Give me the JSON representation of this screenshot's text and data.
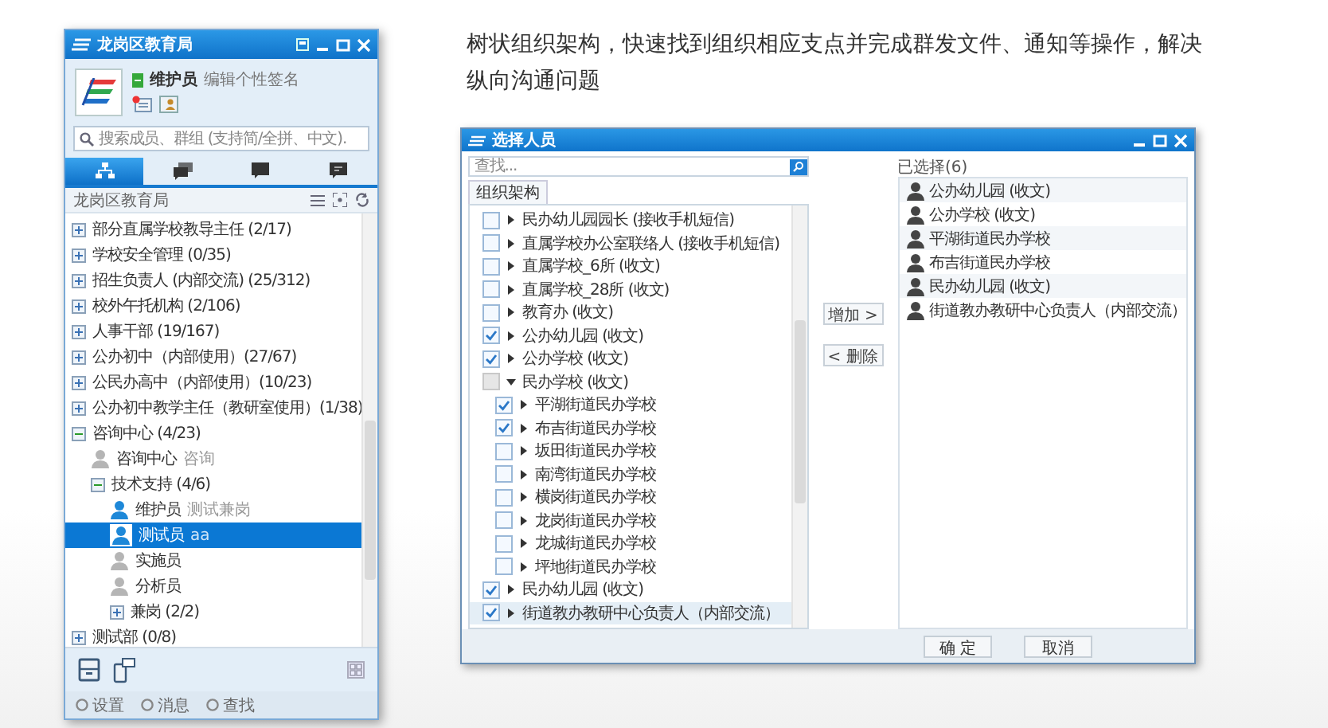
{
  "caption": "树状组织架构，快速找到组织相应支点并完成群发文件、通知等操作，解决纵向沟通问题",
  "im_window": {
    "title": "龙岗区教育局",
    "user": {
      "name": "维护员",
      "signature": "编辑个性签名",
      "online": true
    },
    "search": {
      "placeholder": "搜索成员、群组 (支持简/全拼、中文)."
    },
    "tabs": [
      {
        "kind": "org",
        "selected": true
      },
      {
        "kind": "groups",
        "selected": false
      },
      {
        "kind": "chat",
        "selected": false
      },
      {
        "kind": "notice",
        "selected": false
      }
    ],
    "org_header": "龙岗区教育局",
    "tree": [
      {
        "kind": "group",
        "label": "部分直属学校教导主任 (2/17)",
        "expanded": false,
        "selected": false
      },
      {
        "kind": "group",
        "label": "学校安全管理 (0/35)",
        "expanded": false,
        "selected": false
      },
      {
        "kind": "group",
        "label": "招生负责人 (内部交流) (25/312)",
        "expanded": false,
        "selected": false
      },
      {
        "kind": "group",
        "label": "校外午托机构 (2/106)",
        "expanded": false,
        "selected": false
      },
      {
        "kind": "group",
        "label": "人事干部 (19/167)",
        "expanded": false,
        "selected": false
      },
      {
        "kind": "group",
        "label": "公办初中（内部使用）(27/67)",
        "expanded": false,
        "selected": false
      },
      {
        "kind": "group",
        "label": "公民办高中（内部使用）(10/23)",
        "expanded": false,
        "selected": false
      },
      {
        "kind": "group",
        "label": "公办初中教学主任（教研室使用）(1/38)",
        "expanded": false,
        "selected": false
      },
      {
        "kind": "group",
        "label": "咨询中心 (4/23)",
        "expanded": true,
        "selected": false,
        "children": [
          {
            "kind": "member",
            "name": "咨询中心",
            "note": "咨询",
            "online": false,
            "selected": false
          },
          {
            "kind": "group",
            "label": "技术支持 (4/6)",
            "expanded": true,
            "selected": false,
            "children": [
              {
                "kind": "member",
                "name": "维护员",
                "note": "测试兼岗",
                "online": true,
                "selected": false
              },
              {
                "kind": "member",
                "name": "测试员",
                "note": "aa",
                "online": true,
                "selected": true
              },
              {
                "kind": "member",
                "name": "实施员",
                "online": false,
                "selected": false
              },
              {
                "kind": "member",
                "name": "分析员",
                "online": false,
                "selected": false
              },
              {
                "kind": "group",
                "label": "兼岗 (2/2)",
                "expanded": false,
                "selected": false
              }
            ]
          }
        ]
      },
      {
        "kind": "group",
        "label": "测试部 (0/8)",
        "expanded": false,
        "selected": false
      }
    ],
    "footer": [
      "设置",
      "消息",
      "查找"
    ]
  },
  "dialog": {
    "title": "选择人员",
    "search": {
      "placeholder": "查找..."
    },
    "tab": "组织架构",
    "tree": [
      {
        "label": "民办幼儿园园长 (接收手机短信)",
        "checked": false,
        "partial": false,
        "expanded": false,
        "highlighted": false
      },
      {
        "label": "直属学校办公室联络人 (接收手机短信)",
        "checked": false,
        "partial": false,
        "expanded": false,
        "highlighted": false
      },
      {
        "label": "直属学校_6所 (收文)",
        "checked": false,
        "partial": false,
        "expanded": false,
        "highlighted": false
      },
      {
        "label": "直属学校_28所 (收文)",
        "checked": false,
        "partial": false,
        "expanded": false,
        "highlighted": false
      },
      {
        "label": "教育办 (收文)",
        "checked": false,
        "partial": false,
        "expanded": false,
        "highlighted": false
      },
      {
        "label": "公办幼儿园 (收文)",
        "checked": true,
        "partial": false,
        "expanded": false,
        "highlighted": false
      },
      {
        "label": "公办学校 (收文)",
        "checked": true,
        "partial": false,
        "expanded": false,
        "highlighted": false
      },
      {
        "label": "民办学校 (收文)",
        "checked": false,
        "partial": true,
        "expanded": true,
        "highlighted": false,
        "children": [
          {
            "label": "平湖街道民办学校",
            "checked": true,
            "partial": false,
            "expanded": false,
            "highlighted": false
          },
          {
            "label": "布吉街道民办学校",
            "checked": true,
            "partial": false,
            "expanded": false,
            "highlighted": false
          },
          {
            "label": "坂田街道民办学校",
            "checked": false,
            "partial": false,
            "expanded": false,
            "highlighted": false
          },
          {
            "label": "南湾街道民办学校",
            "checked": false,
            "partial": false,
            "expanded": false,
            "highlighted": false
          },
          {
            "label": "横岗街道民办学校",
            "checked": false,
            "partial": false,
            "expanded": false,
            "highlighted": false
          },
          {
            "label": "龙岗街道民办学校",
            "checked": false,
            "partial": false,
            "expanded": false,
            "highlighted": false
          },
          {
            "label": "龙城街道民办学校",
            "checked": false,
            "partial": false,
            "expanded": false,
            "highlighted": false
          },
          {
            "label": "坪地街道民办学校",
            "checked": false,
            "partial": false,
            "expanded": false,
            "highlighted": false
          }
        ]
      },
      {
        "label": "民办幼儿园 (收文)",
        "checked": true,
        "partial": false,
        "expanded": false,
        "highlighted": false
      },
      {
        "label": "街道教办教研中心负责人（内部交流）",
        "checked": true,
        "partial": false,
        "expanded": false,
        "highlighted": true
      }
    ],
    "add_button": "增加 >",
    "remove_button": "< 删除",
    "chosen_title": "已选择(6)",
    "chosen_items": [
      "公办幼儿园 (收文)",
      "公办学校 (收文)",
      "平湖街道民办学校",
      "布吉街道民办学校",
      "民办幼儿园 (收文)",
      "街道教办教研中心负责人（内部交流）"
    ],
    "ok_button": "确 定",
    "cancel_button": "取消"
  }
}
